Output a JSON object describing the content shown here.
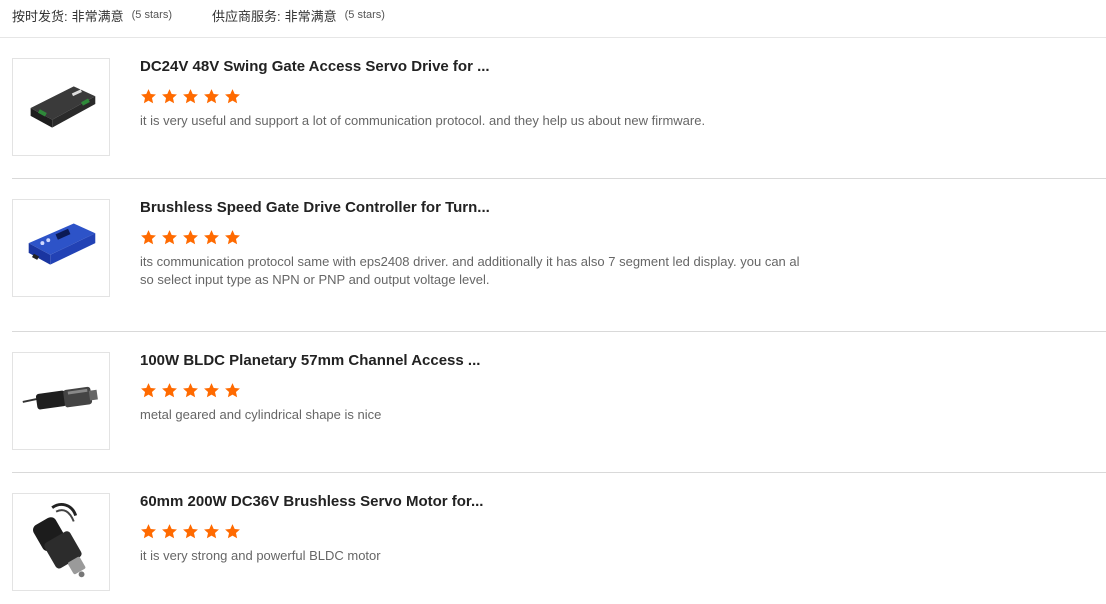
{
  "summary": {
    "delivery_label": "按时发货:",
    "delivery_value": "非常满意",
    "delivery_stars": "(5 stars)",
    "service_label": "供应商服务:",
    "service_value": "非常满意",
    "service_stars": "(5 stars)"
  },
  "reviews": [
    {
      "title": "DC24V 48V Swing Gate Access Servo Drive for ...",
      "rating": 5,
      "text": "it is very useful and support a lot of communication protocol. and they help us about new firmware.",
      "image": "servo-drive-black-image"
    },
    {
      "title": "Brushless Speed Gate Drive Controller for Turn...",
      "rating": 5,
      "text": "its communication protocol same with eps2408 driver. and additionally it has also 7 segment led display. you can also select input type as NPN or PNP and output voltage level.",
      "image": "drive-controller-blue-image"
    },
    {
      "title": "100W BLDC Planetary 57mm Channel Access ...",
      "rating": 5,
      "text": "metal geared and cylindrical shape is nice",
      "image": "planetary-motor-image"
    },
    {
      "title": "60mm 200W DC36V Brushless Servo Motor for...",
      "rating": 5,
      "text": "it is very strong and powerful BLDC motor",
      "image": "servo-motor-image"
    }
  ],
  "colors": {
    "star": "#ff6a00",
    "divider": "#d9d9d9"
  }
}
